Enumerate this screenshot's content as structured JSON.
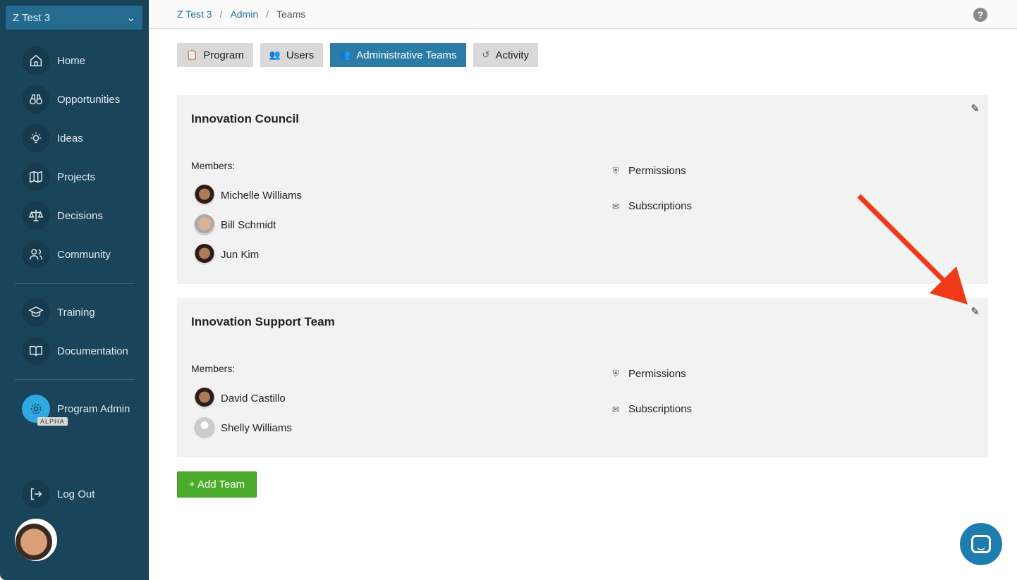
{
  "sidebar": {
    "workspace": "Z Test 3",
    "items": [
      {
        "label": "Home",
        "icon": "home-icon"
      },
      {
        "label": "Opportunities",
        "icon": "binoculars-icon"
      },
      {
        "label": "Ideas",
        "icon": "lightbulb-icon"
      },
      {
        "label": "Projects",
        "icon": "map-icon"
      },
      {
        "label": "Decisions",
        "icon": "scale-icon"
      },
      {
        "label": "Community",
        "icon": "people-icon"
      },
      {
        "label": "Training",
        "icon": "graduation-cap-icon"
      },
      {
        "label": "Documentation",
        "icon": "book-icon"
      },
      {
        "label": "Program Admin",
        "icon": "gear-icon",
        "badge": "ALPHA"
      },
      {
        "label": "Log Out",
        "icon": "logout-icon"
      }
    ]
  },
  "breadcrumb": {
    "items": [
      "Z Test 3",
      "Admin",
      "Teams"
    ],
    "separator": "/"
  },
  "help": "?",
  "tabs": [
    {
      "label": "Program",
      "icon": "clipboard-icon"
    },
    {
      "label": "Users",
      "icon": "users-icon"
    },
    {
      "label": "Administrative Teams",
      "icon": "users-icon",
      "active": true
    },
    {
      "label": "Activity",
      "icon": "history-icon"
    }
  ],
  "teams": [
    {
      "name": "Innovation Council",
      "members_label": "Members:",
      "members": [
        "Michelle Williams",
        "Bill Schmidt",
        "Jun Kim"
      ],
      "links": [
        "Permissions",
        "Subscriptions"
      ]
    },
    {
      "name": "Innovation Support Team",
      "members_label": "Members:",
      "members": [
        "David Castillo",
        "Shelly Williams"
      ],
      "links": [
        "Permissions",
        "Subscriptions"
      ]
    }
  ],
  "add_team_label": "+ Add Team",
  "colors": {
    "sidebar": "#1a4459",
    "accent": "#2a7ba6",
    "add": "#4aab2a",
    "arrow": "#f03a17"
  }
}
